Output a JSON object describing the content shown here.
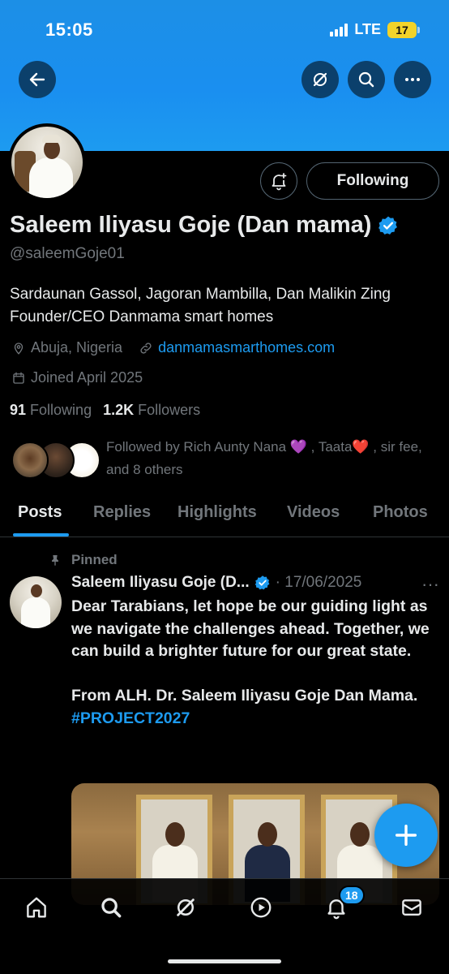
{
  "status_bar": {
    "time": "15:05",
    "network": "LTE",
    "battery": "17"
  },
  "header": {
    "back_icon": "arrow-left-icon",
    "grok_icon": "grok-icon",
    "search_icon": "search-icon",
    "more_icon": "more-horizontal-icon"
  },
  "profile": {
    "notify_icon": "bell-plus-icon",
    "following_label": "Following",
    "display_name": "Saleem Iliyasu Goje (Dan mama)",
    "handle": "@saleemGoje01",
    "bio": "Sardaunan Gassol, Jagoran Mambilla, Dan Malikin Zing Founder/CEO Danmama smart homes",
    "location": "Abuja, Nigeria",
    "website": "danmamasmarthomes.com",
    "joined": "Joined April 2025",
    "following_count": "91",
    "following_word": "Following",
    "followers_count": "1.2K",
    "followers_word": "Followers",
    "followed_by": "Followed by Rich Aunty Nana 💜 , Taata❤️ , sir fee, and 8 others"
  },
  "tabs": [
    {
      "label": "Posts",
      "active": true
    },
    {
      "label": "Replies",
      "active": false
    },
    {
      "label": "Highlights",
      "active": false
    },
    {
      "label": "Videos",
      "active": false
    },
    {
      "label": "Photos",
      "active": false
    }
  ],
  "post": {
    "pinned_label": "Pinned",
    "author": "Saleem Iliyasu Goje (D...",
    "date": "· 17/06/2025",
    "more": "···",
    "text": "Dear Tarabians, let hope be our guiding light as we navigate the challenges ahead. Together, we can build a brighter future for our great state.\n\nFrom ALH. Dr. Saleem Iliyasu Goje Dan Mama.",
    "hashtag": "#PROJECT2027"
  },
  "bottom_nav": {
    "items": [
      "home-icon",
      "search-icon",
      "grok-icon",
      "video-icon",
      "notifications-icon",
      "messages-icon"
    ],
    "notification_badge": "18"
  },
  "colors": {
    "accent": "#1d9bf0",
    "background": "#000000",
    "muted": "#71767b",
    "text": "#e7e9ea"
  }
}
